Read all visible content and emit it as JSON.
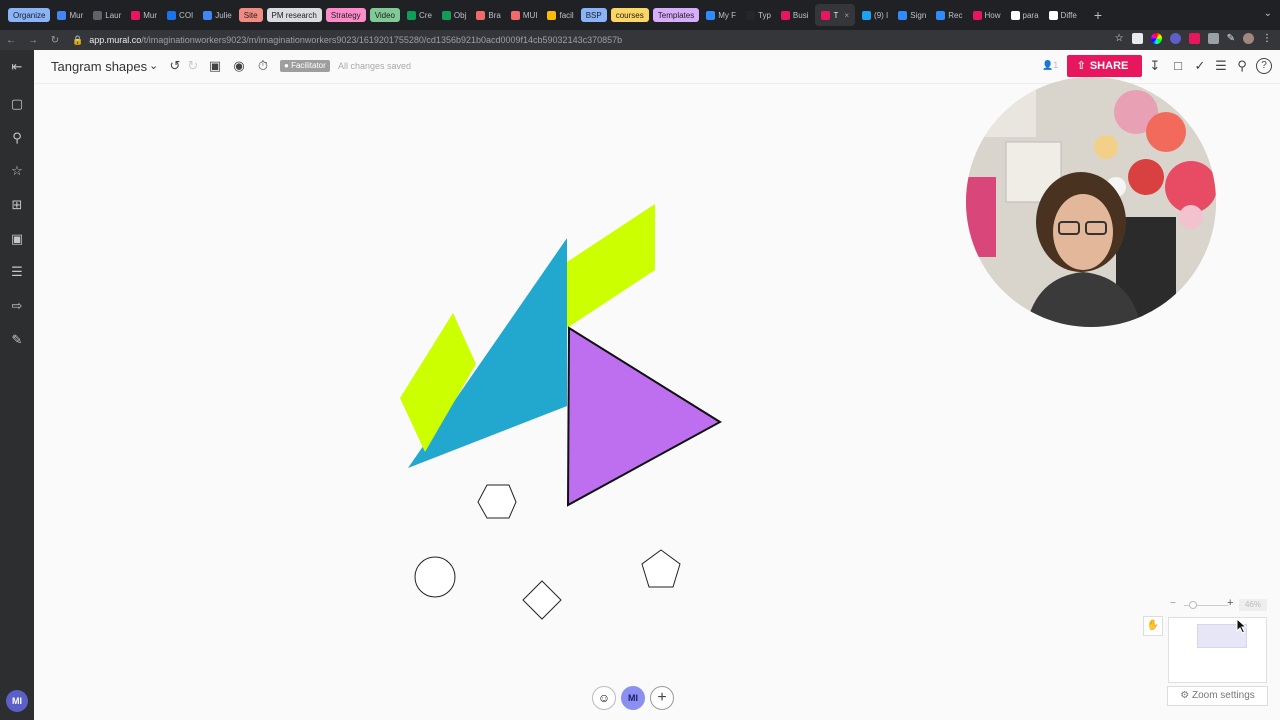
{
  "browser": {
    "tabs": [
      {
        "label": "Organize",
        "color": "#8ab4f8",
        "pill": true
      },
      {
        "label": "Mur",
        "fav": "#4285f4"
      },
      {
        "label": "Laur",
        "fav": "#5f6368"
      },
      {
        "label": "Mur",
        "fav": "#e8175d"
      },
      {
        "label": "COI",
        "fav": "#1a73e8"
      },
      {
        "label": "Julie",
        "fav": "#4285f4"
      },
      {
        "label": "Site",
        "color": "#f28b82",
        "pill": true
      },
      {
        "label": "PM research",
        "color": "#dadce0",
        "pill": true
      },
      {
        "label": "Strategy",
        "color": "#ff8bcb",
        "pill": true
      },
      {
        "label": "Video",
        "color": "#81c995",
        "pill": true
      },
      {
        "label": "Cre",
        "fav": "#0f9d58"
      },
      {
        "label": "Obj",
        "fav": "#0f9d58"
      },
      {
        "label": "Bra",
        "fav": "#f06a6a"
      },
      {
        "label": "MUI",
        "fav": "#f06a6a"
      },
      {
        "label": "facil",
        "fav": "#fbbc04"
      },
      {
        "label": "BSP",
        "color": "#8ab4f8",
        "pill": true
      },
      {
        "label": "courses",
        "color": "#fdd663",
        "pill": true
      },
      {
        "label": "Templates",
        "color": "#d7aefb",
        "pill": true
      },
      {
        "label": "My F",
        "fav": "#2d8cff"
      },
      {
        "label": "Typ",
        "fav": "#262627"
      },
      {
        "label": "Busi",
        "fav": "#e8175d"
      },
      {
        "label": "T",
        "fav": "#e8175d",
        "active": true
      },
      {
        "label": "(9) I",
        "fav": "#1da1f2"
      },
      {
        "label": "Sign",
        "fav": "#2d8cff"
      },
      {
        "label": "Rec",
        "fav": "#2d8cff"
      },
      {
        "label": "How",
        "fav": "#e8175d"
      },
      {
        "label": "para",
        "fav": "#ffffff"
      },
      {
        "label": "Diffe",
        "fav": "#ffffff"
      }
    ],
    "url_host": "app.mural.co",
    "url_path": "/t/imaginationworkers9023/m/imaginationworkers9023/1619201755280/cd1356b921b0acd0009f14cb59032143c370857b"
  },
  "topbar": {
    "title": "Tangram shapes",
    "facilitator_label": "Facilitator",
    "saved_status": "All changes saved",
    "user_count": "1",
    "share_label": "SHARE"
  },
  "sidebar": {
    "avatar_initials": "MI"
  },
  "bottom": {
    "me_initials": "MI"
  },
  "zoom": {
    "level": "46%",
    "settings_label": "Zoom settings"
  },
  "colors": {
    "brand_pink": "#e8175d",
    "tangram_lime": "#ccff00",
    "tangram_blue": "#22a7cf",
    "tangram_purple": "#bd6ff0"
  }
}
